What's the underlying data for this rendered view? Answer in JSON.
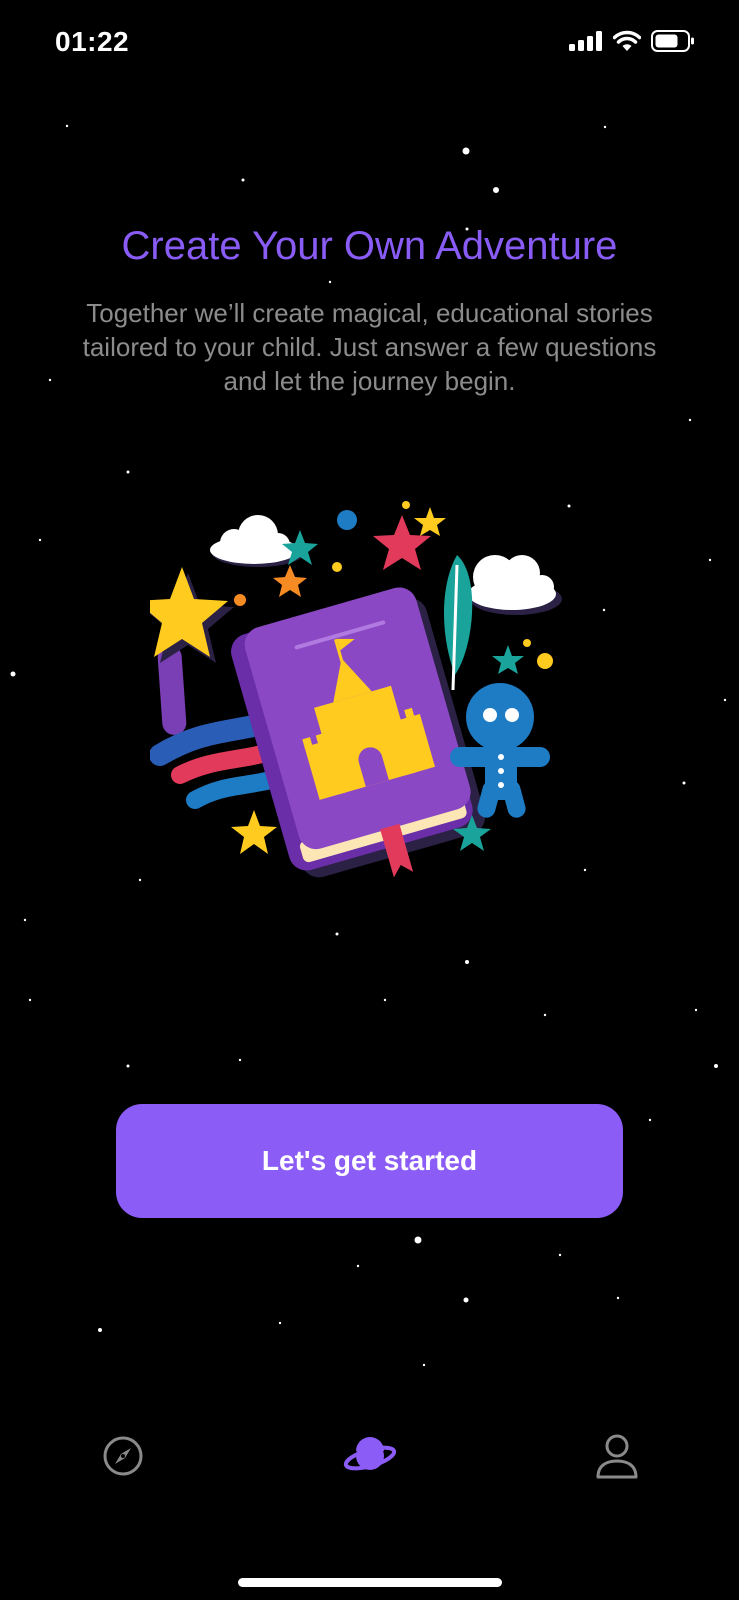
{
  "status_bar": {
    "time": "01:22",
    "icons": [
      "cellular-signal-icon",
      "wifi-icon",
      "battery-icon"
    ]
  },
  "onboarding": {
    "title": "Create Your Own Adventure",
    "subtitle": "Together we’ll create magical, educational stories tailored to your child. Just answer a few questions and let the journey begin.",
    "cta_label": "Let's get started"
  },
  "tab_bar": {
    "tabs": [
      {
        "icon": "compass-icon",
        "selected": false
      },
      {
        "icon": "planet-icon",
        "selected": true
      },
      {
        "icon": "profile-icon",
        "selected": false
      }
    ]
  },
  "colors": {
    "background": "#000000",
    "accent": "#8b5cf6",
    "subtitle": "#8c8c8c",
    "tab_inactive": "#8a8a8a"
  }
}
